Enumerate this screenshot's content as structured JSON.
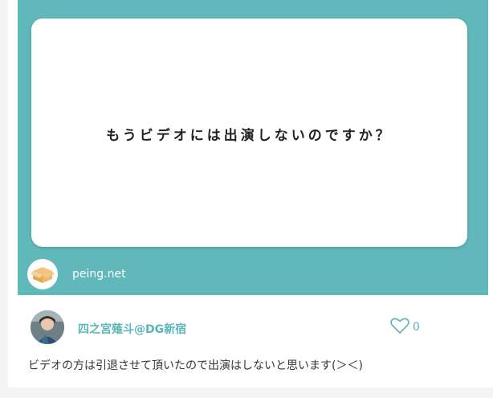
{
  "question": {
    "text": "もうビデオには出演しないのですか？"
  },
  "brand": {
    "domain": "peing.net",
    "logo_icon": "cardboard-box-icon"
  },
  "answerer": {
    "name": "四之宮薙斗@DG新宿",
    "avatar_icon": "user-avatar"
  },
  "like": {
    "icon": "heart-icon",
    "count": "0"
  },
  "answer": {
    "text": "ビデオの方は引退させて頂いたので出演はしないと思います(＞＜)"
  },
  "colors": {
    "teal": "#61b8bb",
    "accent_text": "#5bb6b8",
    "card": "#ffffff",
    "page_bg": "#f3f3f3"
  }
}
